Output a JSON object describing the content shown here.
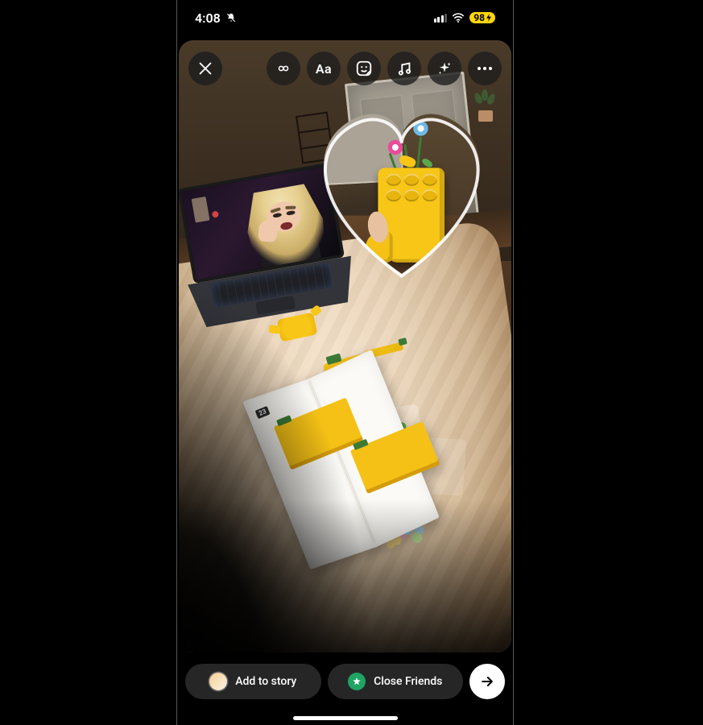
{
  "status_bar": {
    "time": "4:08",
    "silent_mode": true,
    "battery_percent": "98",
    "charging": true
  },
  "toolbar": {
    "close": "Close",
    "boomerang": "Boomerang",
    "text": "Aa",
    "sticker": "Stickers",
    "music": "Music",
    "effects": "Effects",
    "more": "More"
  },
  "share": {
    "add_to_story": "Add to story",
    "close_friends": "Close Friends",
    "send": "Send"
  },
  "content": {
    "overlay_shape": "heart",
    "instruction_step": "23"
  }
}
